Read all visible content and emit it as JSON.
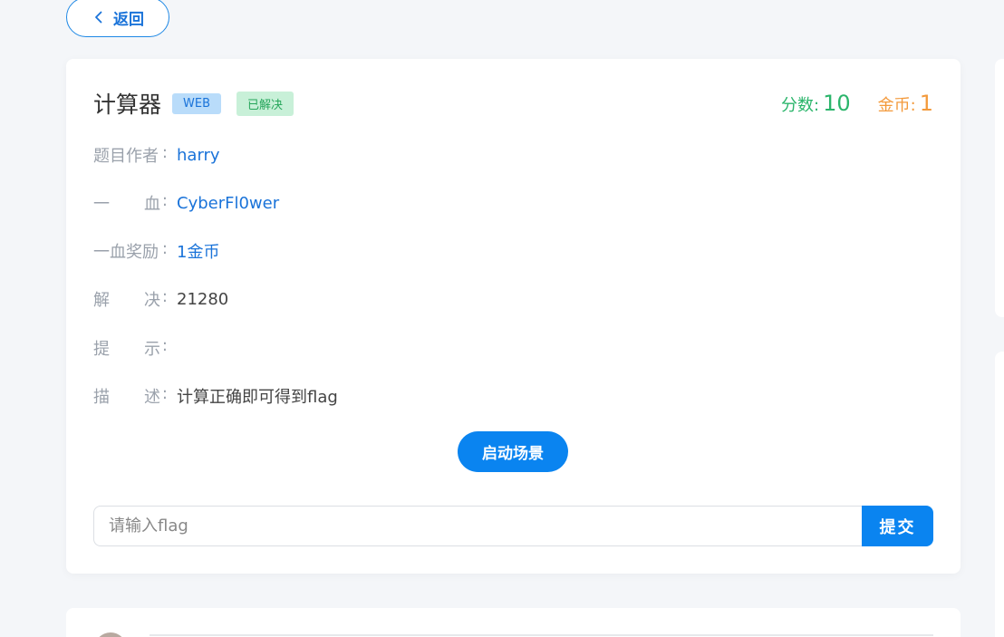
{
  "back": {
    "label": "返回"
  },
  "challenge": {
    "title": "计算器",
    "category_tag": "WEB",
    "status_tag": "已解决",
    "score_label": "分数:",
    "score_value": "10",
    "coin_label": "金币:",
    "coin_value": "1"
  },
  "info": {
    "author": {
      "label_a": "题目作者",
      "value": "harry"
    },
    "first_blood": {
      "label_a": "一",
      "label_b": "血",
      "value": "CyberFl0wer"
    },
    "first_blood_reward": {
      "label_a": "一血奖励",
      "value": "1金币"
    },
    "solves": {
      "label_a": "解",
      "label_b": "决",
      "value": "21280"
    },
    "hint": {
      "label_a": "提",
      "label_b": "示",
      "value": ""
    },
    "description": {
      "label_a": "描",
      "label_b": "述",
      "value": "计算正确即可得到flag"
    },
    "colon": ":"
  },
  "actions": {
    "start_label": "启动场景",
    "flag_placeholder": "请输入flag",
    "submit_label": "提交"
  },
  "colors": {
    "primary": "#0a84f0",
    "score": "#2bb56b",
    "coin": "#f39a3c"
  }
}
